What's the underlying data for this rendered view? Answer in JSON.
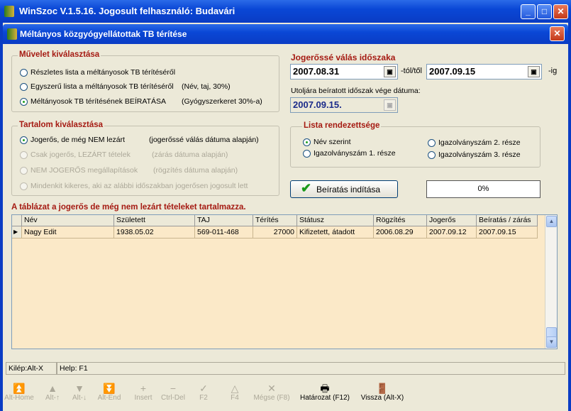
{
  "window": {
    "title": "WinSzoc V.1.5.16.  Jogosult felhasználó: Budavári"
  },
  "dialog": {
    "title": "Méltányos közgyógyellátottak TB térítése"
  },
  "operation": {
    "legend": "Művelet kiválasztása",
    "options": [
      {
        "label": "Részletes lista a méltányosok TB térítéséről",
        "note": "",
        "selected": false
      },
      {
        "label": "Egyszerű lista a méltányosok TB térítéséről",
        "note": "(Név, taj, 30%)",
        "selected": false
      },
      {
        "label": "Méltányosok TB térítésének BEÍRATÁSA",
        "note": "(Gyógyszerkeret 30%-a)",
        "selected": true
      }
    ]
  },
  "content": {
    "legend": "Tartalom kiválasztása",
    "options": [
      {
        "label": "Jogerős, de még NEM lezárt",
        "note": "(jogerőssé válás dátuma alapján)",
        "selected": true,
        "disabled": false
      },
      {
        "label": "Csak jogerős, LEZÁRT tételek",
        "note": "(zárás dátuma alapján)",
        "selected": false,
        "disabled": true
      },
      {
        "label": "NEM JOGERŐS megállapítások",
        "note": "(rögzítés dátuma alapján)",
        "selected": false,
        "disabled": true
      },
      {
        "label": "Mindenkit kikeres, aki az alábbi időszakban jogerősen jogosult  lett",
        "note": "",
        "selected": false,
        "disabled": true
      }
    ]
  },
  "period": {
    "label": "Jogerőssé válás időszaka",
    "from": "2007.08.31",
    "from_suffix": "-tól/től",
    "to": "2007.09.15",
    "to_suffix": "-ig",
    "last_label": "Utoljára beíratott időszak vége dátuma:",
    "last_value": "2007.09.15."
  },
  "order": {
    "legend": "Lista rendezettsége",
    "options": [
      {
        "label": "Név szerint",
        "selected": true
      },
      {
        "label": "Igazolványszám 1. része",
        "selected": false
      },
      {
        "label": "Igazolványszám 2. része",
        "selected": false
      },
      {
        "label": "Igazolványszám 3. része",
        "selected": false
      }
    ]
  },
  "start_button": "Beíratás indítása",
  "progress": {
    "text": "0%",
    "value": 0
  },
  "table_caption": "A táblázat a jogerős de még nem lezárt tételeket tartalmazza.",
  "table": {
    "columns": [
      "Név",
      "Született",
      "TAJ",
      "Térítés",
      "Státusz",
      "Rögzítés",
      "Jogerős",
      "Beíratás / zárás"
    ],
    "rows": [
      [
        "Nagy Edit",
        "1938.05.02",
        "569-011-468",
        "27000",
        "Kifizetett, átadott",
        "2006.08.29",
        "2007.09.12",
        "2007.09.15"
      ]
    ]
  },
  "status": {
    "exit": "Kilép:Alt-X",
    "help": "Help: F1"
  },
  "toolbar": [
    {
      "label": "Alt-Home",
      "icon": "first-record-icon",
      "glyph": "⏫",
      "enabled": false
    },
    {
      "label": "Alt-↑",
      "icon": "up-arrow-icon",
      "glyph": "▲",
      "enabled": false
    },
    {
      "label": "Alt-↓",
      "icon": "down-arrow-icon",
      "glyph": "▼",
      "enabled": false
    },
    {
      "label": "Alt-End",
      "icon": "last-record-icon",
      "glyph": "⏬",
      "enabled": false
    },
    {
      "label": "Insert",
      "icon": "plus-icon",
      "glyph": "+",
      "enabled": false
    },
    {
      "label": "Ctrl-Del",
      "icon": "minus-icon",
      "glyph": "−",
      "enabled": false
    },
    {
      "label": "F2",
      "icon": "check-icon",
      "glyph": "✓",
      "enabled": false
    },
    {
      "label": "F4",
      "icon": "triangle-icon",
      "glyph": "△",
      "enabled": false
    },
    {
      "label": "Mégse (F8)",
      "icon": "cancel-icon",
      "glyph": "✕",
      "enabled": false
    },
    {
      "label": "Határozat (F12)",
      "icon": "printer-icon",
      "glyph": "🖶",
      "enabled": true
    },
    {
      "label": "Vissza (Alt-X)",
      "icon": "exit-door-icon",
      "glyph": "🚪",
      "enabled": true
    }
  ]
}
